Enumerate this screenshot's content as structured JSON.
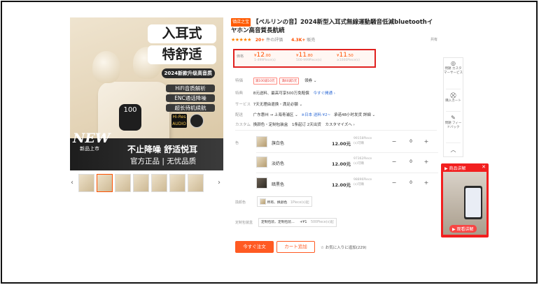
{
  "gallery": {
    "headline1": "入耳式",
    "headline2": "特舒适",
    "badge_new_model": "2024新款升级高音质",
    "features": [
      "HiFi音质解析",
      "ENC通话降噪",
      "超长待机续航"
    ],
    "case_display": "100",
    "hires_logo": "Hi-Res AUDIO",
    "new_label": "NEW",
    "new_launch": "新品上市",
    "slogan1": "不止降噪 舒适悦耳",
    "slogan2": "官方正品 | 无忧品质",
    "prev_arrow": "‹",
    "next_arrow": "›"
  },
  "product": {
    "shop_tag": "镇店之宝",
    "title": "【ベルリンの音】2024新型入耳式無線運動騒音低減bluetoothイヤホン高音質長航続",
    "stars": "★★★★★",
    "rating": "20+",
    "rating_label": "件の評価",
    "sales": "4.3K+",
    "sales_label": "販売",
    "share": "共有"
  },
  "pricing": {
    "label": "価格",
    "tiers": [
      {
        "currency": "¥",
        "int": "12",
        "dec": ".00",
        "qty": "1-499Piece(s)"
      },
      {
        "currency": "¥",
        "int": "11",
        "dec": ".80",
        "qty": "500-999Piece(s)"
      },
      {
        "currency": "¥",
        "int": "11",
        "dec": ".50",
        "qty": "≥1000Piece(s)"
      }
    ]
  },
  "attributes": {
    "promo_label": "特価",
    "promo_chips": [
      "満100減10元",
      "満60減5元"
    ],
    "promo_more": "領券 ⌄",
    "benefit_label": "特典",
    "benefit_text": "8元送料、最高可享500万免賠償",
    "benefit_link": "今すぐ開通 ›",
    "service_label": "サービス",
    "service_text": "7天无理由退换・満足必額 ⌄",
    "ship_label": "配送",
    "ship_text": "广东惠州 → 上海青浦区 ⌄",
    "ship_japan": "※日本 送料:¥2~",
    "ship_time": "承诺48小时发货 詳細 ⌄",
    "custom_label": "カスタム",
    "custom_text": "换颜色・定制包装盒",
    "custom_moq": "1条起订 2天出货",
    "custom_link": "カスタマイズへ ›"
  },
  "variants": {
    "label": "色",
    "rows": [
      {
        "name": "旗白色",
        "price": "12.00元",
        "stock_a": "99158Piece",
        "stock_b": "(s)可購",
        "qty": "0"
      },
      {
        "name": "淡奶色",
        "price": "12.00元",
        "stock_a": "97362Piece",
        "stock_b": "(s)可購",
        "qty": "0"
      },
      {
        "name": "暗黒色",
        "price": "12.00元",
        "stock_a": "98896Piece",
        "stock_b": "(s)可購",
        "qty": "0"
      }
    ]
  },
  "options": {
    "color_change_label": "換颜色",
    "color_change_text": "所有、换颜色",
    "color_change_moq": "1Piece(s)起",
    "custom_pkg_label": "定制包装盒",
    "custom_pkg_text": "定制包装、定制包装...",
    "custom_pkg_price": "+¥1",
    "custom_pkg_moq": "500Piece(s)起"
  },
  "actions": {
    "buy_now": "今すぐ注文",
    "add_cart": "カート追加",
    "favorite": "お気に入りに追加(229)"
  },
  "sidebar": {
    "items": [
      {
        "icon": "headset-icon",
        "glyph": "◎",
        "label": "問題 カスタマーサービス"
      },
      {
        "icon": "cart-icon",
        "glyph": "⛒",
        "label": "購入カート"
      },
      {
        "icon": "feedback-icon",
        "glyph": "✎",
        "label": "問題 フィードバック"
      },
      {
        "icon": "up-arrow-icon",
        "glyph": "︿",
        "label": ""
      }
    ]
  },
  "video_panel": {
    "title": "▶ 商品讲解",
    "close": "✕",
    "footer": "▶ 观看讲解"
  }
}
